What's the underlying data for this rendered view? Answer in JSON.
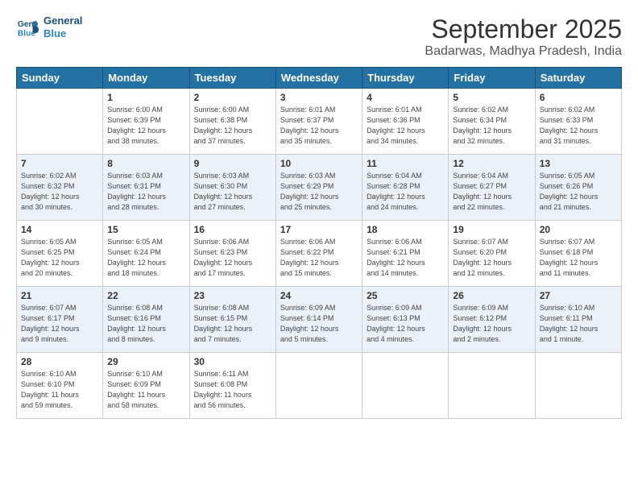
{
  "logo": {
    "line1": "General",
    "line2": "Blue"
  },
  "title": "September 2025",
  "location": "Badarwas, Madhya Pradesh, India",
  "days_of_week": [
    "Sunday",
    "Monday",
    "Tuesday",
    "Wednesday",
    "Thursday",
    "Friday",
    "Saturday"
  ],
  "weeks": [
    [
      {
        "num": "",
        "info": ""
      },
      {
        "num": "1",
        "info": "Sunrise: 6:00 AM\nSunset: 6:39 PM\nDaylight: 12 hours\nand 38 minutes."
      },
      {
        "num": "2",
        "info": "Sunrise: 6:00 AM\nSunset: 6:38 PM\nDaylight: 12 hours\nand 37 minutes."
      },
      {
        "num": "3",
        "info": "Sunrise: 6:01 AM\nSunset: 6:37 PM\nDaylight: 12 hours\nand 35 minutes."
      },
      {
        "num": "4",
        "info": "Sunrise: 6:01 AM\nSunset: 6:36 PM\nDaylight: 12 hours\nand 34 minutes."
      },
      {
        "num": "5",
        "info": "Sunrise: 6:02 AM\nSunset: 6:34 PM\nDaylight: 12 hours\nand 32 minutes."
      },
      {
        "num": "6",
        "info": "Sunrise: 6:02 AM\nSunset: 6:33 PM\nDaylight: 12 hours\nand 31 minutes."
      }
    ],
    [
      {
        "num": "7",
        "info": "Sunrise: 6:02 AM\nSunset: 6:32 PM\nDaylight: 12 hours\nand 30 minutes."
      },
      {
        "num": "8",
        "info": "Sunrise: 6:03 AM\nSunset: 6:31 PM\nDaylight: 12 hours\nand 28 minutes."
      },
      {
        "num": "9",
        "info": "Sunrise: 6:03 AM\nSunset: 6:30 PM\nDaylight: 12 hours\nand 27 minutes."
      },
      {
        "num": "10",
        "info": "Sunrise: 6:03 AM\nSunset: 6:29 PM\nDaylight: 12 hours\nand 25 minutes."
      },
      {
        "num": "11",
        "info": "Sunrise: 6:04 AM\nSunset: 6:28 PM\nDaylight: 12 hours\nand 24 minutes."
      },
      {
        "num": "12",
        "info": "Sunrise: 6:04 AM\nSunset: 6:27 PM\nDaylight: 12 hours\nand 22 minutes."
      },
      {
        "num": "13",
        "info": "Sunrise: 6:05 AM\nSunset: 6:26 PM\nDaylight: 12 hours\nand 21 minutes."
      }
    ],
    [
      {
        "num": "14",
        "info": "Sunrise: 6:05 AM\nSunset: 6:25 PM\nDaylight: 12 hours\nand 20 minutes."
      },
      {
        "num": "15",
        "info": "Sunrise: 6:05 AM\nSunset: 6:24 PM\nDaylight: 12 hours\nand 18 minutes."
      },
      {
        "num": "16",
        "info": "Sunrise: 6:06 AM\nSunset: 6:23 PM\nDaylight: 12 hours\nand 17 minutes."
      },
      {
        "num": "17",
        "info": "Sunrise: 6:06 AM\nSunset: 6:22 PM\nDaylight: 12 hours\nand 15 minutes."
      },
      {
        "num": "18",
        "info": "Sunrise: 6:06 AM\nSunset: 6:21 PM\nDaylight: 12 hours\nand 14 minutes."
      },
      {
        "num": "19",
        "info": "Sunrise: 6:07 AM\nSunset: 6:20 PM\nDaylight: 12 hours\nand 12 minutes."
      },
      {
        "num": "20",
        "info": "Sunrise: 6:07 AM\nSunset: 6:18 PM\nDaylight: 12 hours\nand 11 minutes."
      }
    ],
    [
      {
        "num": "21",
        "info": "Sunrise: 6:07 AM\nSunset: 6:17 PM\nDaylight: 12 hours\nand 9 minutes."
      },
      {
        "num": "22",
        "info": "Sunrise: 6:08 AM\nSunset: 6:16 PM\nDaylight: 12 hours\nand 8 minutes."
      },
      {
        "num": "23",
        "info": "Sunrise: 6:08 AM\nSunset: 6:15 PM\nDaylight: 12 hours\nand 7 minutes."
      },
      {
        "num": "24",
        "info": "Sunrise: 6:09 AM\nSunset: 6:14 PM\nDaylight: 12 hours\nand 5 minutes."
      },
      {
        "num": "25",
        "info": "Sunrise: 6:09 AM\nSunset: 6:13 PM\nDaylight: 12 hours\nand 4 minutes."
      },
      {
        "num": "26",
        "info": "Sunrise: 6:09 AM\nSunset: 6:12 PM\nDaylight: 12 hours\nand 2 minutes."
      },
      {
        "num": "27",
        "info": "Sunrise: 6:10 AM\nSunset: 6:11 PM\nDaylight: 12 hours\nand 1 minute."
      }
    ],
    [
      {
        "num": "28",
        "info": "Sunrise: 6:10 AM\nSunset: 6:10 PM\nDaylight: 11 hours\nand 59 minutes."
      },
      {
        "num": "29",
        "info": "Sunrise: 6:10 AM\nSunset: 6:09 PM\nDaylight: 11 hours\nand 58 minutes."
      },
      {
        "num": "30",
        "info": "Sunrise: 6:11 AM\nSunset: 6:08 PM\nDaylight: 11 hours\nand 56 minutes."
      },
      {
        "num": "",
        "info": ""
      },
      {
        "num": "",
        "info": ""
      },
      {
        "num": "",
        "info": ""
      },
      {
        "num": "",
        "info": ""
      }
    ]
  ]
}
